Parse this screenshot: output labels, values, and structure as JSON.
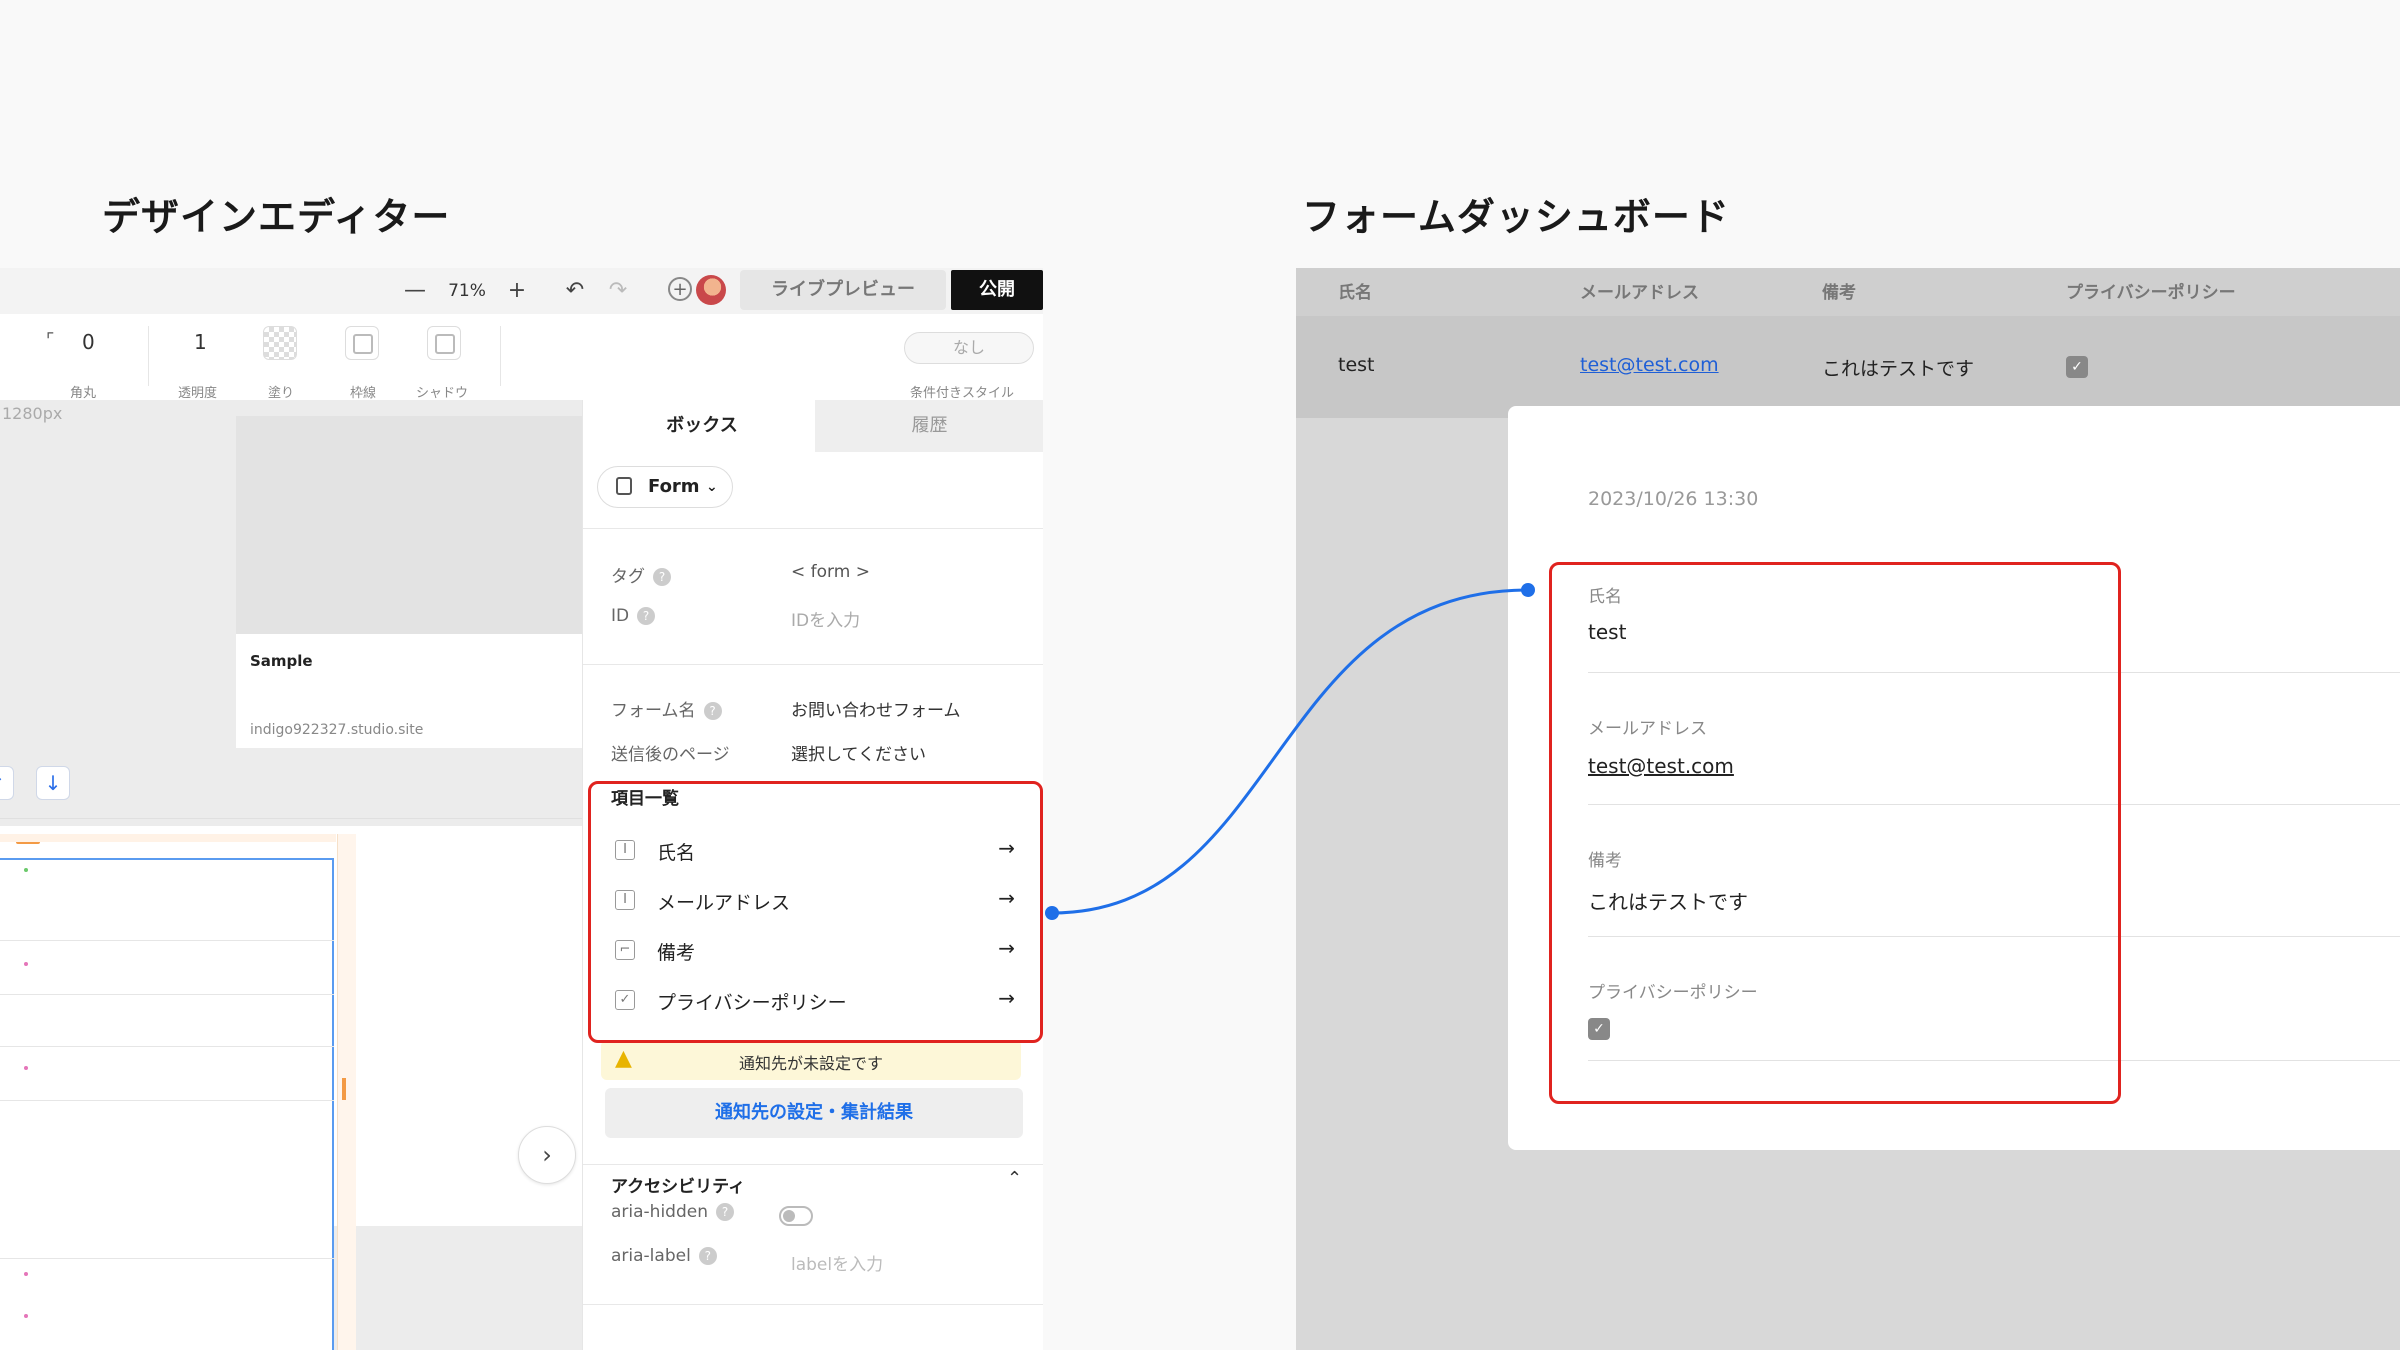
{
  "headings": {
    "editor": "デザインエディター",
    "dashboard": "フォームダッシュボード"
  },
  "editor": {
    "toolbar": {
      "zoom_out": "—",
      "zoom": "71%",
      "zoom_in": "+",
      "undo": "↶",
      "redo": "↷",
      "add": "+",
      "preview": "ライブプレビュー",
      "publish": "公開"
    },
    "props": {
      "radius_value": "0",
      "radius_label": "角丸",
      "opacity_value": "1",
      "opacity_label": "透明度",
      "fill_label": "塗り",
      "border_label": "枠線",
      "shadow_label": "シャドウ",
      "conditional_value": "なし",
      "conditional_label": "条件付きスタイル"
    },
    "canvas": {
      "width_label": "1280px",
      "card_title": "Sample",
      "card_url": "indigo922327.studio.site"
    },
    "panel": {
      "tabs": [
        "ボックス",
        "履歴"
      ],
      "form_button": "Form",
      "tag_label": "タグ",
      "tag_value": "< form >",
      "id_label": "ID",
      "id_placeholder": "IDを入力",
      "form_name_label": "フォーム名",
      "form_name_value": "お問い合わせフォーム",
      "after_page_label": "送信後のページ",
      "after_page_value": "選択してください",
      "items_title": "項目一覧",
      "items": [
        {
          "label": "氏名",
          "icon": "text-field-icon"
        },
        {
          "label": "メールアドレス",
          "icon": "text-field-icon"
        },
        {
          "label": "備考",
          "icon": "textarea-icon"
        },
        {
          "label": "プライバシーポリシー",
          "icon": "checkbox-icon"
        }
      ],
      "warning": "通知先が未設定です",
      "notice_button": "通知先の設定・集計結果",
      "a11y_title": "アクセシビリティ",
      "aria_hidden_label": "aria-hidden",
      "aria_label_label": "aria-label",
      "aria_label_placeholder": "labelを入力"
    }
  },
  "dashboard": {
    "columns": [
      "氏名",
      "メールアドレス",
      "備考",
      "プライバシーポリシー"
    ],
    "row": {
      "name": "test",
      "email": "test@test.com",
      "note": "これはテストです",
      "privacy_checked": true
    },
    "detail": {
      "date": "2023/10/26 13:30",
      "fields": [
        {
          "label": "氏名",
          "value": "test"
        },
        {
          "label": "メールアドレス",
          "value": "test@test.com"
        },
        {
          "label": "備考",
          "value": "これはテストです"
        },
        {
          "label": "プライバシーポリシー",
          "value": "✓"
        }
      ]
    }
  },
  "colors": {
    "highlight": "#e0231f",
    "connector": "#1f6fe8",
    "link": "#1f5fd6",
    "publish_bg": "#111111"
  }
}
